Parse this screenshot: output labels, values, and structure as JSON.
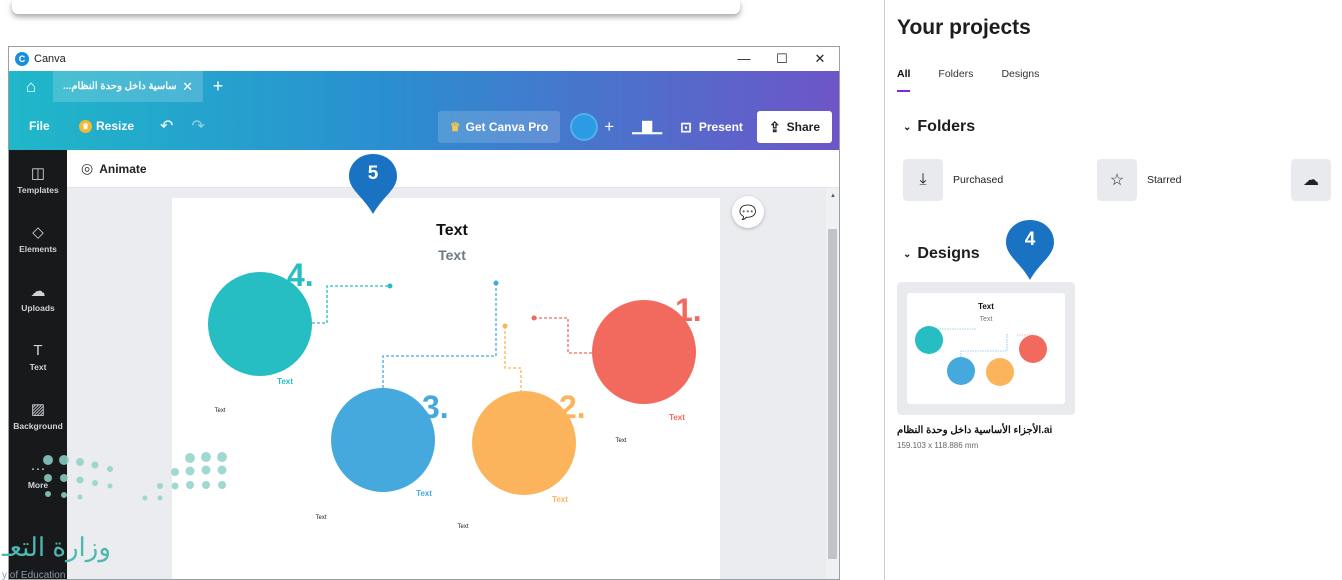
{
  "app_window": {
    "title": "Canva",
    "controls": [
      "—",
      "☐",
      "✕"
    ],
    "doc_tab_label": "...ساسية داخل وحدة النظام",
    "toolbar": {
      "file": "File",
      "resize": "Resize",
      "get_pro": "Get Canva Pro",
      "present": "Present",
      "share": "Share"
    },
    "sidebar": [
      {
        "label": "Templates",
        "icon": "templates-icon",
        "glyph": "◫"
      },
      {
        "label": "Elements",
        "icon": "elements-icon",
        "glyph": "◇"
      },
      {
        "label": "Uploads",
        "icon": "upload-cloud-icon",
        "glyph": "☁"
      },
      {
        "label": "Text",
        "icon": "text-T-icon",
        "glyph": "T"
      },
      {
        "label": "Background",
        "icon": "background-icon",
        "glyph": "▨"
      },
      {
        "label": "More",
        "icon": "more-dots-icon",
        "glyph": "···"
      }
    ],
    "animate_label": "Animate"
  },
  "canvas_design": {
    "title": "Text",
    "subtitle": "Text",
    "items": [
      {
        "number": "1.",
        "color": "#f26a5e",
        "label": "Text",
        "caption": "Text"
      },
      {
        "number": "2.",
        "color": "#fbb45c",
        "label": "Text",
        "caption": "Text"
      },
      {
        "number": "3.",
        "color": "#46a9de",
        "label": "Text",
        "caption": "Text"
      },
      {
        "number": "4.",
        "color": "#26bdc3",
        "label": "Text",
        "caption": "Text"
      }
    ],
    "extra_caption": "Text"
  },
  "markers": {
    "step5": "5",
    "step4": "4"
  },
  "projects": {
    "title": "Your projects",
    "tabs": [
      "All",
      "Folders",
      "Designs"
    ],
    "folders_heading": "Folders",
    "folders": [
      "Purchased",
      "Starred"
    ],
    "designs_heading": "Designs",
    "design": {
      "name": "الأجزاء الأساسية داخل وحدة النظام.ai",
      "size": "159.103 x 118.886 mm",
      "thumb_title": "Text",
      "thumb_subtitle": "Text"
    }
  },
  "watermark": {
    "text": "وزارة التعـ",
    "sub": "y of Education"
  },
  "colors": {
    "accent": "#7d2ae8",
    "marker": "#1a73c2",
    "sidebar": "#18191b"
  }
}
